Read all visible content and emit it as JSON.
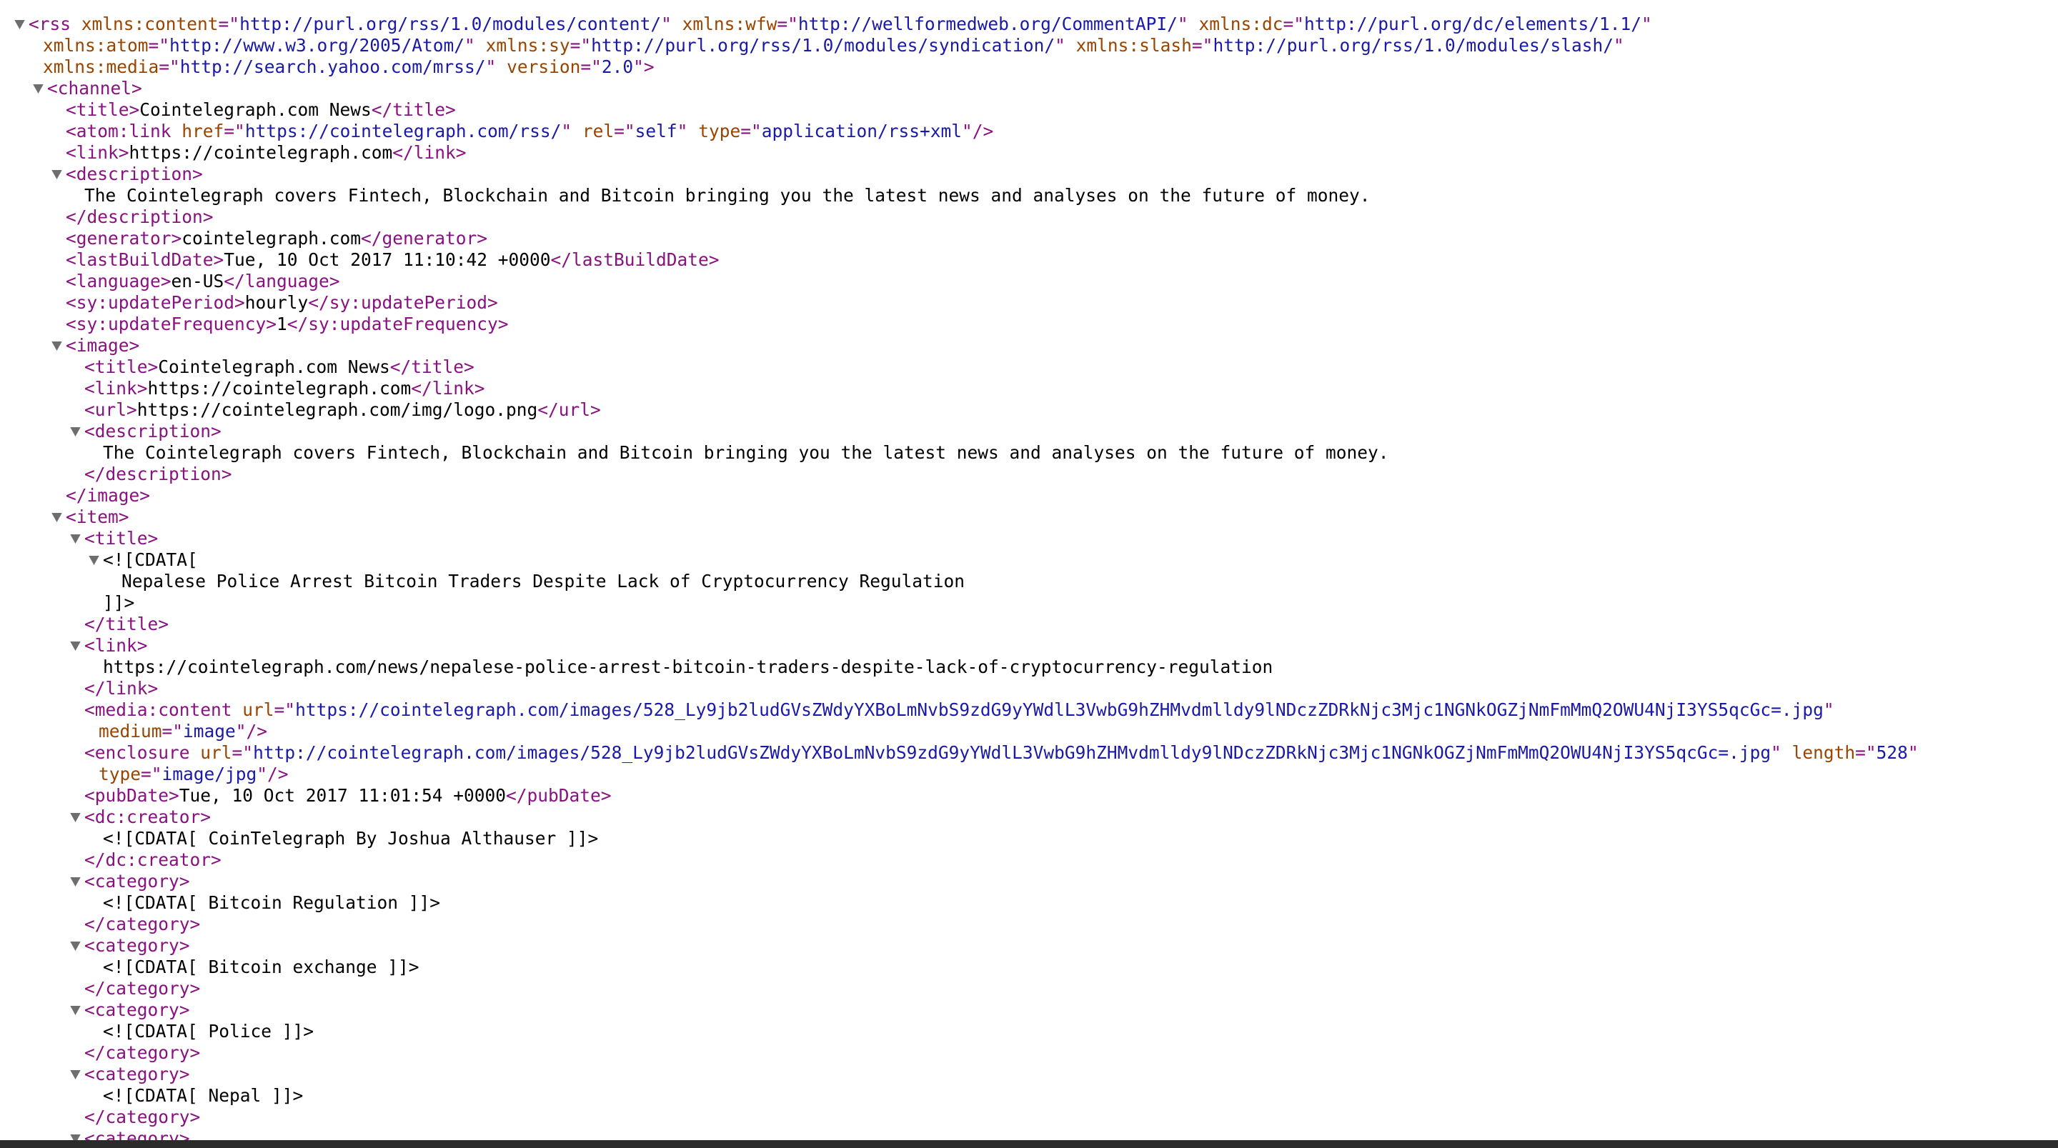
{
  "colors": {
    "tag": "#881280",
    "attr_name": "#994500",
    "attr_value": "#1a1aa6",
    "text": "#000000",
    "toggle": "#6e6e6e",
    "bottom_bar": "#2b2b2b"
  },
  "lines": [
    {
      "indent": 0,
      "toggle": true,
      "parts": [
        [
          "t",
          "<rss"
        ],
        [
          "x",
          " "
        ],
        [
          "an",
          "xmlns:content"
        ],
        [
          "t",
          "=\""
        ],
        [
          "av",
          "http://purl.org/rss/1.0/modules/content/"
        ],
        [
          "t",
          "\""
        ],
        [
          "x",
          " "
        ],
        [
          "an",
          "xmlns:wfw"
        ],
        [
          "t",
          "=\""
        ],
        [
          "av",
          "http://wellformedweb.org/CommentAPI/"
        ],
        [
          "t",
          "\""
        ],
        [
          "x",
          " "
        ],
        [
          "an",
          "xmlns:dc"
        ],
        [
          "t",
          "=\""
        ],
        [
          "av",
          "http://purl.org/dc/elements/1.1/"
        ],
        [
          "t",
          "\""
        ]
      ]
    },
    {
      "indent": 0,
      "cont": true,
      "parts": [
        [
          "an",
          "xmlns:atom"
        ],
        [
          "t",
          "=\""
        ],
        [
          "av",
          "http://www.w3.org/2005/Atom/"
        ],
        [
          "t",
          "\""
        ],
        [
          "x",
          " "
        ],
        [
          "an",
          "xmlns:sy"
        ],
        [
          "t",
          "=\""
        ],
        [
          "av",
          "http://purl.org/rss/1.0/modules/syndication/"
        ],
        [
          "t",
          "\""
        ],
        [
          "x",
          " "
        ],
        [
          "an",
          "xmlns:slash"
        ],
        [
          "t",
          "=\""
        ],
        [
          "av",
          "http://purl.org/rss/1.0/modules/slash/"
        ],
        [
          "t",
          "\""
        ]
      ]
    },
    {
      "indent": 0,
      "cont": true,
      "parts": [
        [
          "an",
          "xmlns:media"
        ],
        [
          "t",
          "=\""
        ],
        [
          "av",
          "http://search.yahoo.com/mrss/"
        ],
        [
          "t",
          "\""
        ],
        [
          "x",
          " "
        ],
        [
          "an",
          "version"
        ],
        [
          "t",
          "=\""
        ],
        [
          "av",
          "2.0"
        ],
        [
          "t",
          "\">"
        ]
      ]
    },
    {
      "indent": 1,
      "toggle": true,
      "parts": [
        [
          "t",
          "<channel>"
        ]
      ]
    },
    {
      "indent": 2,
      "parts": [
        [
          "t",
          "<title>"
        ],
        [
          "x",
          "Cointelegraph.com News"
        ],
        [
          "t",
          "</title>"
        ]
      ]
    },
    {
      "indent": 2,
      "parts": [
        [
          "t",
          "<atom:link"
        ],
        [
          "x",
          " "
        ],
        [
          "an",
          "href"
        ],
        [
          "t",
          "=\""
        ],
        [
          "av",
          "https://cointelegraph.com/rss/"
        ],
        [
          "t",
          "\""
        ],
        [
          "x",
          " "
        ],
        [
          "an",
          "rel"
        ],
        [
          "t",
          "=\""
        ],
        [
          "av",
          "self"
        ],
        [
          "t",
          "\""
        ],
        [
          "x",
          " "
        ],
        [
          "an",
          "type"
        ],
        [
          "t",
          "=\""
        ],
        [
          "av",
          "application/rss+xml"
        ],
        [
          "t",
          "\"/>"
        ]
      ]
    },
    {
      "indent": 2,
      "parts": [
        [
          "t",
          "<link>"
        ],
        [
          "x",
          "https://cointelegraph.com"
        ],
        [
          "t",
          "</link>"
        ]
      ]
    },
    {
      "indent": 2,
      "toggle": true,
      "parts": [
        [
          "t",
          "<description>"
        ]
      ]
    },
    {
      "indent": 3,
      "parts": [
        [
          "x",
          "The Cointelegraph covers Fintech, Blockchain and Bitcoin bringing you the latest news and analyses on the future of money."
        ]
      ]
    },
    {
      "indent": 2,
      "parts": [
        [
          "t",
          "</description>"
        ]
      ]
    },
    {
      "indent": 2,
      "parts": [
        [
          "t",
          "<generator>"
        ],
        [
          "x",
          "cointelegraph.com"
        ],
        [
          "t",
          "</generator>"
        ]
      ]
    },
    {
      "indent": 2,
      "parts": [
        [
          "t",
          "<lastBuildDate>"
        ],
        [
          "x",
          "Tue, 10 Oct 2017 11:10:42 +0000"
        ],
        [
          "t",
          "</lastBuildDate>"
        ]
      ]
    },
    {
      "indent": 2,
      "parts": [
        [
          "t",
          "<language>"
        ],
        [
          "x",
          "en-US"
        ],
        [
          "t",
          "</language>"
        ]
      ]
    },
    {
      "indent": 2,
      "parts": [
        [
          "t",
          "<sy:updatePeriod>"
        ],
        [
          "x",
          "hourly"
        ],
        [
          "t",
          "</sy:updatePeriod>"
        ]
      ]
    },
    {
      "indent": 2,
      "parts": [
        [
          "t",
          "<sy:updateFrequency>"
        ],
        [
          "x",
          "1"
        ],
        [
          "t",
          "</sy:updateFrequency>"
        ]
      ]
    },
    {
      "indent": 2,
      "toggle": true,
      "parts": [
        [
          "t",
          "<image>"
        ]
      ]
    },
    {
      "indent": 3,
      "parts": [
        [
          "t",
          "<title>"
        ],
        [
          "x",
          "Cointelegraph.com News"
        ],
        [
          "t",
          "</title>"
        ]
      ]
    },
    {
      "indent": 3,
      "parts": [
        [
          "t",
          "<link>"
        ],
        [
          "x",
          "https://cointelegraph.com"
        ],
        [
          "t",
          "</link>"
        ]
      ]
    },
    {
      "indent": 3,
      "parts": [
        [
          "t",
          "<url>"
        ],
        [
          "x",
          "https://cointelegraph.com/img/logo.png"
        ],
        [
          "t",
          "</url>"
        ]
      ]
    },
    {
      "indent": 3,
      "toggle": true,
      "parts": [
        [
          "t",
          "<description>"
        ]
      ]
    },
    {
      "indent": 4,
      "parts": [
        [
          "x",
          "The Cointelegraph covers Fintech, Blockchain and Bitcoin bringing you the latest news and analyses on the future of money."
        ]
      ]
    },
    {
      "indent": 3,
      "parts": [
        [
          "t",
          "</description>"
        ]
      ]
    },
    {
      "indent": 2,
      "parts": [
        [
          "t",
          "</image>"
        ]
      ]
    },
    {
      "indent": 2,
      "toggle": true,
      "parts": [
        [
          "t",
          "<item>"
        ]
      ]
    },
    {
      "indent": 3,
      "toggle": true,
      "parts": [
        [
          "t",
          "<title>"
        ]
      ]
    },
    {
      "indent": 4,
      "toggle": true,
      "parts": [
        [
          "x",
          "<![CDATA["
        ]
      ]
    },
    {
      "indent": 5,
      "parts": [
        [
          "x",
          "Nepalese Police Arrest Bitcoin Traders Despite Lack of Cryptocurrency Regulation"
        ]
      ]
    },
    {
      "indent": 4,
      "parts": [
        [
          "x",
          "]]>"
        ]
      ]
    },
    {
      "indent": 3,
      "parts": [
        [
          "t",
          "</title>"
        ]
      ]
    },
    {
      "indent": 3,
      "toggle": true,
      "parts": [
        [
          "t",
          "<link>"
        ]
      ]
    },
    {
      "indent": 4,
      "parts": [
        [
          "x",
          "https://cointelegraph.com/news/nepalese-police-arrest-bitcoin-traders-despite-lack-of-cryptocurrency-regulation"
        ]
      ]
    },
    {
      "indent": 3,
      "parts": [
        [
          "t",
          "</link>"
        ]
      ]
    },
    {
      "indent": 3,
      "parts": [
        [
          "t",
          "<media:content"
        ],
        [
          "x",
          " "
        ],
        [
          "an",
          "url"
        ],
        [
          "t",
          "=\""
        ],
        [
          "av",
          "https://cointelegraph.com/images/528_Ly9jb2ludGVsZWdyYXBoLmNvbS9zdG9yYWdlL3VwbG9hZHMvdmlldy9lNDczZDRkNjc3Mjc1NGNkOGZjNmFmMmQ2OWU4NjI3YS5qcGc=.jpg"
        ],
        [
          "t",
          "\""
        ]
      ]
    },
    {
      "indent": 3,
      "cont": true,
      "parts": [
        [
          "an",
          "medium"
        ],
        [
          "t",
          "=\""
        ],
        [
          "av",
          "image"
        ],
        [
          "t",
          "\"/>"
        ]
      ]
    },
    {
      "indent": 3,
      "parts": [
        [
          "t",
          "<enclosure"
        ],
        [
          "x",
          " "
        ],
        [
          "an",
          "url"
        ],
        [
          "t",
          "=\""
        ],
        [
          "av",
          "http://cointelegraph.com/images/528_Ly9jb2ludGVsZWdyYXBoLmNvbS9zdG9yYWdlL3VwbG9hZHMvdmlldy9lNDczZDRkNjc3Mjc1NGNkOGZjNmFmMmQ2OWU4NjI3YS5qcGc=.jpg"
        ],
        [
          "t",
          "\""
        ],
        [
          "x",
          " "
        ],
        [
          "an",
          "length"
        ],
        [
          "t",
          "=\""
        ],
        [
          "av",
          "528"
        ],
        [
          "t",
          "\""
        ]
      ]
    },
    {
      "indent": 3,
      "cont": true,
      "parts": [
        [
          "an",
          "type"
        ],
        [
          "t",
          "=\""
        ],
        [
          "av",
          "image/jpg"
        ],
        [
          "t",
          "\"/>"
        ]
      ]
    },
    {
      "indent": 3,
      "parts": [
        [
          "t",
          "<pubDate>"
        ],
        [
          "x",
          "Tue, 10 Oct 2017 11:01:54 +0000"
        ],
        [
          "t",
          "</pubDate>"
        ]
      ]
    },
    {
      "indent": 3,
      "toggle": true,
      "parts": [
        [
          "t",
          "<dc:creator>"
        ]
      ]
    },
    {
      "indent": 4,
      "parts": [
        [
          "x",
          "<![CDATA[ CoinTelegraph By Joshua Althauser ]]>"
        ]
      ]
    },
    {
      "indent": 3,
      "parts": [
        [
          "t",
          "</dc:creator>"
        ]
      ]
    },
    {
      "indent": 3,
      "toggle": true,
      "parts": [
        [
          "t",
          "<category>"
        ]
      ]
    },
    {
      "indent": 4,
      "parts": [
        [
          "x",
          "<![CDATA[ Bitcoin Regulation ]]>"
        ]
      ]
    },
    {
      "indent": 3,
      "parts": [
        [
          "t",
          "</category>"
        ]
      ]
    },
    {
      "indent": 3,
      "toggle": true,
      "parts": [
        [
          "t",
          "<category>"
        ]
      ]
    },
    {
      "indent": 4,
      "parts": [
        [
          "x",
          "<![CDATA[ Bitcoin exchange ]]>"
        ]
      ]
    },
    {
      "indent": 3,
      "parts": [
        [
          "t",
          "</category>"
        ]
      ]
    },
    {
      "indent": 3,
      "toggle": true,
      "parts": [
        [
          "t",
          "<category>"
        ]
      ]
    },
    {
      "indent": 4,
      "parts": [
        [
          "x",
          "<![CDATA[ Police ]]>"
        ]
      ]
    },
    {
      "indent": 3,
      "parts": [
        [
          "t",
          "</category>"
        ]
      ]
    },
    {
      "indent": 3,
      "toggle": true,
      "parts": [
        [
          "t",
          "<category>"
        ]
      ]
    },
    {
      "indent": 4,
      "parts": [
        [
          "x",
          "<![CDATA[ Nepal ]]>"
        ]
      ]
    },
    {
      "indent": 3,
      "parts": [
        [
          "t",
          "</category>"
        ]
      ]
    },
    {
      "indent": 3,
      "toggle": true,
      "parts": [
        [
          "t",
          "<category>"
        ]
      ]
    }
  ]
}
